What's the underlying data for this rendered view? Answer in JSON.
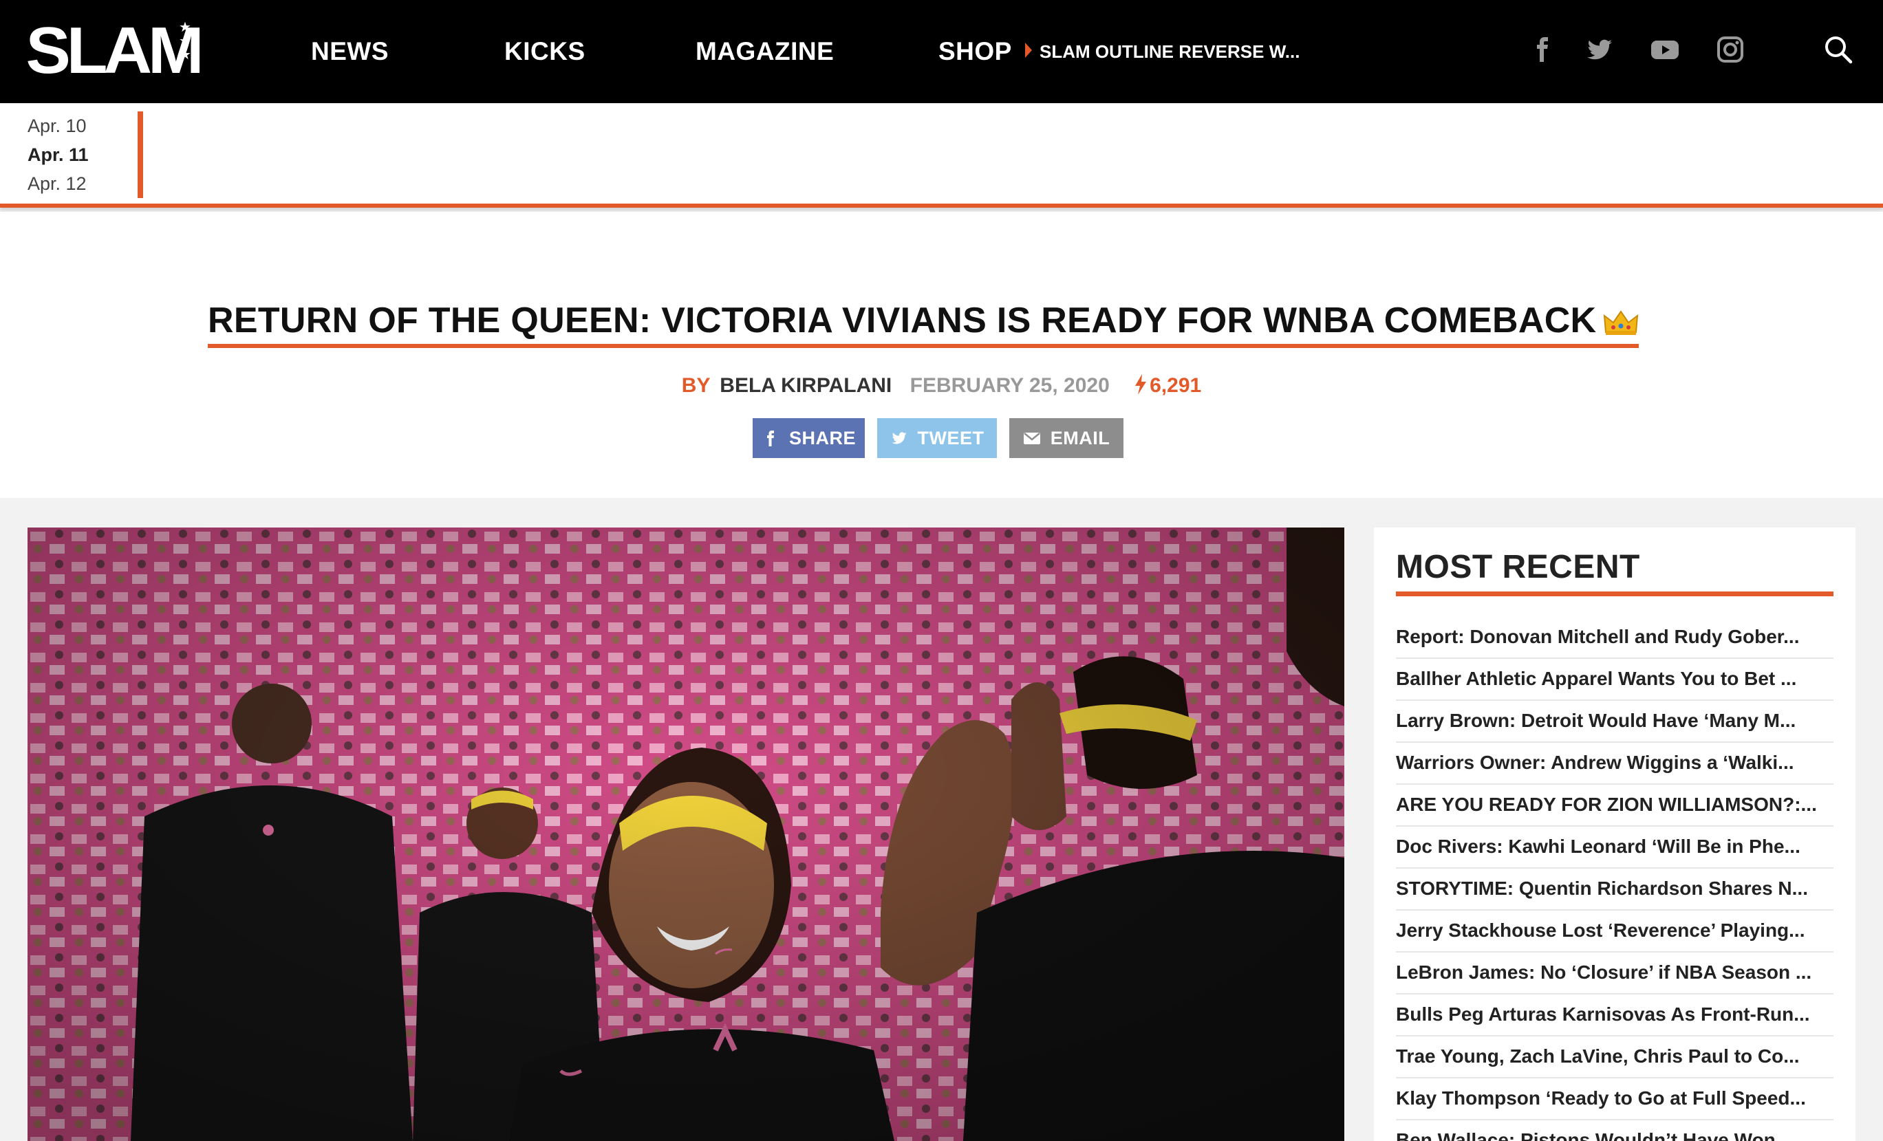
{
  "header": {
    "logo_text": "SLAM",
    "nav": [
      {
        "label": "NEWS"
      },
      {
        "label": "KICKS"
      },
      {
        "label": "MAGAZINE"
      },
      {
        "label": "SHOP"
      }
    ],
    "shop_promo": "SLAM OUTLINE REVERSE W...",
    "social_icons": [
      "facebook-icon",
      "twitter-icon",
      "youtube-icon",
      "instagram-icon"
    ],
    "search_icon": "search-icon"
  },
  "date_strip": {
    "dates": [
      "Apr. 10",
      "Apr. 11",
      "Apr. 12"
    ],
    "active_index": 1
  },
  "article": {
    "title": "RETURN OF THE QUEEN: VICTORIA VIVIANS IS READY FOR WNBA COMEBACK",
    "title_emoji": "crown-icon",
    "by_label": "BY",
    "author": "BELA KIRPALANI",
    "date": "FEBRUARY 25, 2020",
    "views": "6,291",
    "share_buttons": {
      "share": "SHARE",
      "tweet": "TWEET",
      "email": "EMAIL"
    }
  },
  "sidebar": {
    "title": "MOST RECENT",
    "items": [
      "Report: Donovan Mitchell and Rudy Gober...",
      "Ballher Athletic Apparel Wants You to Bet ...",
      "Larry Brown: Detroit Would Have ‘Many M...",
      "Warriors Owner: Andrew Wiggins a ‘Walki...",
      "ARE YOU READY FOR ZION WILLIAMSON?:...",
      "Doc Rivers: Kawhi Leonard ‘Will Be in Phe...",
      "STORYTIME: Quentin Richardson Shares N...",
      "Jerry Stackhouse Lost ‘Reverence’ Playing...",
      "LeBron James: No ‘Closure’ if NBA Season ...",
      "Bulls Peg Arturas Karnisovas As Front-Run...",
      "Trae Young, Zach LaVine, Chris Paul to Co...",
      "Klay Thompson ‘Ready to Go at Full Speed...",
      "Ben Wallace: Pistons Wouldn’t Have Won..."
    ]
  },
  "colors": {
    "accent": "#e35a2a",
    "header_bg": "#000000",
    "share_fb": "#5b73b2",
    "share_tw": "#8fc4ea",
    "share_email": "#8d8d8d"
  }
}
